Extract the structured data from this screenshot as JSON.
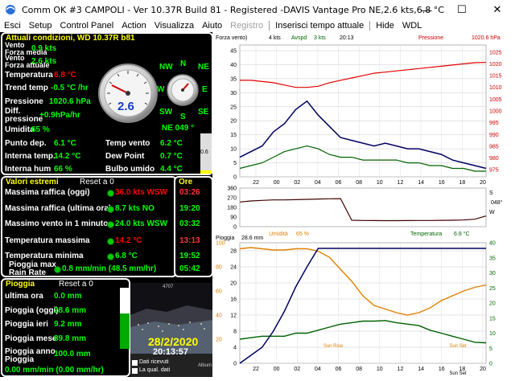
{
  "window": {
    "title": "Comm OK  #3 CAMPOLI - Ver 10.37R Build 81 - Registered  -DAVIS Vantage Pro  NE,2.6 kts,6.8 °C",
    "minimize_icon": "minimize-icon",
    "maximize_icon": "maximize-icon",
    "close_icon": "close-icon"
  },
  "menu": {
    "items": [
      "Esci",
      "Setup",
      "Control Panel",
      "Action",
      "Visualizza",
      "Aiuto",
      "Registro",
      "Inserisci tempo attuale",
      "Hide",
      "WDL"
    ]
  },
  "current": {
    "header": "Attuali condizioni, WD 10.37R b81",
    "rows": [
      {
        "label": "Vento\nForza media",
        "value": "0.9 kts"
      },
      {
        "label": "Vento\nForza attuale",
        "value": "2.6 kts"
      },
      {
        "label": "Temperatura",
        "value": "6.8 °C"
      },
      {
        "label": "Trend temp",
        "value": "-0.5 °C /hr"
      },
      {
        "label": "Pressione",
        "value": "1020.6 hPa"
      },
      {
        "label": "Diff.\npressione",
        "value": "+0.9hPa/hr"
      },
      {
        "label": "Umidita",
        "value": "65 %"
      },
      {
        "label": "Punto dep.",
        "value": "6.1 °C"
      },
      {
        "label": "Interna temp.",
        "value": "14.2 °C"
      },
      {
        "label": "Interna hum",
        "value": "66 %"
      }
    ],
    "right_rows": [
      {
        "label": "Temp vento",
        "value": "6.2 °C"
      },
      {
        "label": "Dew Point",
        "value": "0.7 °C"
      },
      {
        "label": "Bulbo umido",
        "value": "4.4 °C"
      }
    ],
    "wind_dir_text": "NE  049 °",
    "gauge_speed": "2.6",
    "compass": [
      "N",
      "NE",
      "E",
      "SE",
      "S",
      "SW",
      "W",
      "NW"
    ],
    "side_bar_value": "0.6"
  },
  "extremes": {
    "header": "Valori estremi",
    "reset": "Reset a 0",
    "time_header": "Ore",
    "rows": [
      {
        "label": "Massima raffica (oggi)",
        "value": "36.0 kts WSW",
        "time": "03:26"
      },
      {
        "label": "Massima raffica (ultima ora)",
        "value": "8.7 kts  NO",
        "time": "19:20"
      },
      {
        "label": "Massimo vento in 1 minuto",
        "value": "24.0 kts WSW",
        "time": "03:32"
      },
      {
        "label": "Temperatura massima",
        "value": "14.2 °C",
        "time": "13:13"
      },
      {
        "label": "Temperatura minima",
        "value": "6.8 °C",
        "time": "19:52"
      },
      {
        "label": "Pioggia max\nRain Rate",
        "value": "0.8 mm/min (48.5 mm/hr)",
        "time": "05:42"
      }
    ]
  },
  "rain": {
    "header": "Pioggia",
    "reset": "Reset a 0",
    "rows": [
      {
        "label": "ultima ora",
        "value": "0.0 mm"
      },
      {
        "label": "Pioggia (oggi)",
        "value": "28.6 mm"
      },
      {
        "label": "Pioggia ieri",
        "value": "9.2 mm"
      },
      {
        "label": "Pioggia mese",
        "value": "89.8 mm"
      },
      {
        "label": "Pioggia anno\nPioggia",
        "value": "100.0 mm"
      }
    ],
    "rate": "0.00 mm/min (0.00 mm/hr)"
  },
  "webcam": {
    "date": "28/2/2020",
    "time": "20:13:57",
    "small_num": "4707",
    "legend1": "Dati ricevuti",
    "legend2": "La qual. dati",
    "albums": "Album"
  },
  "chart_data": [
    {
      "type": "line",
      "title": "",
      "header_labels": [
        "Forza vento)",
        "4 kts",
        "Avspd",
        "3 kts",
        "20:13",
        "Pressione",
        "1020.6 hPa"
      ],
      "x_ticks": [
        "22",
        "00",
        "02",
        "04",
        "06",
        "08",
        "10",
        "12",
        "14",
        "16",
        "18",
        "20"
      ],
      "y_left_ticks": [
        0,
        5,
        10,
        15,
        20,
        25,
        30,
        35,
        40,
        45
      ],
      "y_right_ticks": [
        975,
        980,
        985,
        990,
        995,
        1000,
        1005,
        1010,
        1015,
        1020,
        1025
      ],
      "series": [
        {
          "name": "Pressione",
          "color": "#e00000",
          "values": [
            1013,
            1013,
            1012.5,
            1012,
            1011,
            1010,
            1010,
            1010.5,
            1012,
            1013,
            1014,
            1015,
            1016,
            1016.5,
            1017,
            1017.5,
            1018,
            1018.5,
            1019,
            1019.5,
            1020,
            1020.5,
            1020.6
          ]
        },
        {
          "name": "Forza vento",
          "color": "#000060",
          "values": [
            7,
            9,
            11,
            16,
            19,
            24,
            27,
            22,
            18,
            14,
            13,
            12,
            11,
            12,
            11,
            10,
            10,
            9,
            8,
            6,
            5,
            4,
            3
          ]
        },
        {
          "name": "Avspd",
          "color": "#006000",
          "values": [
            3,
            4,
            5,
            7,
            9,
            10,
            11,
            10,
            8,
            7,
            7,
            6,
            6,
            6,
            6,
            5,
            5,
            4,
            4,
            3,
            3,
            2,
            2
          ]
        }
      ]
    },
    {
      "type": "line",
      "title": "",
      "y_ticks": [
        0,
        90,
        180,
        270,
        360
      ],
      "right_labels": [
        "S",
        "048°",
        "W"
      ],
      "series": [
        {
          "name": "wind direction",
          "color": "#400000",
          "values": [
            230,
            240,
            245,
            250,
            250,
            252,
            255,
            258,
            260,
            262,
            60,
            58,
            57,
            56,
            56,
            57,
            58,
            58,
            59,
            60,
            62,
            70,
            100
          ]
        }
      ]
    },
    {
      "type": "line",
      "title": "",
      "header_labels": [
        "Pioggia",
        "28.6 mm",
        "Umidità",
        "65 %",
        "Temperatura",
        "6.8 °C"
      ],
      "x_ticks": [
        "22",
        "00",
        "02",
        "04",
        "06",
        "08",
        "10",
        "12",
        "14",
        "16",
        "18",
        "20"
      ],
      "y_left_ticks": [
        0,
        4,
        8,
        12,
        16,
        20,
        24,
        28
      ],
      "y_right_ticks": [
        0,
        5,
        10,
        15,
        20,
        25,
        30,
        35,
        40
      ],
      "y_left_extra": [
        100,
        80,
        60,
        40,
        20
      ],
      "annotations": [
        "Sun Rise",
        "Sun Set",
        "Sun Set"
      ],
      "series": [
        {
          "name": "Umidità",
          "color": "#e08000",
          "values": [
            95,
            96,
            95,
            94,
            94,
            95,
            95,
            93,
            88,
            78,
            68,
            56,
            48,
            45,
            42,
            40,
            42,
            46,
            52,
            56,
            60,
            63,
            65
          ]
        },
        {
          "name": "Temperatura",
          "color": "#006000",
          "values": [
            8,
            8.5,
            9,
            9,
            9,
            10,
            10,
            11,
            12,
            13,
            13.5,
            14,
            14,
            14.2,
            13.5,
            13,
            12.5,
            11,
            10,
            9,
            8,
            7,
            6.8
          ]
        },
        {
          "name": "Pioggia",
          "color": "#000060",
          "values": [
            0,
            2,
            4,
            8,
            13,
            19,
            24,
            28.6,
            28.6,
            28.6,
            28.6,
            28.6,
            28.6,
            28.6,
            28.6,
            28.6,
            28.6,
            28.6,
            28.6,
            28.6,
            28.6,
            28.6,
            28.6
          ]
        }
      ]
    }
  ]
}
